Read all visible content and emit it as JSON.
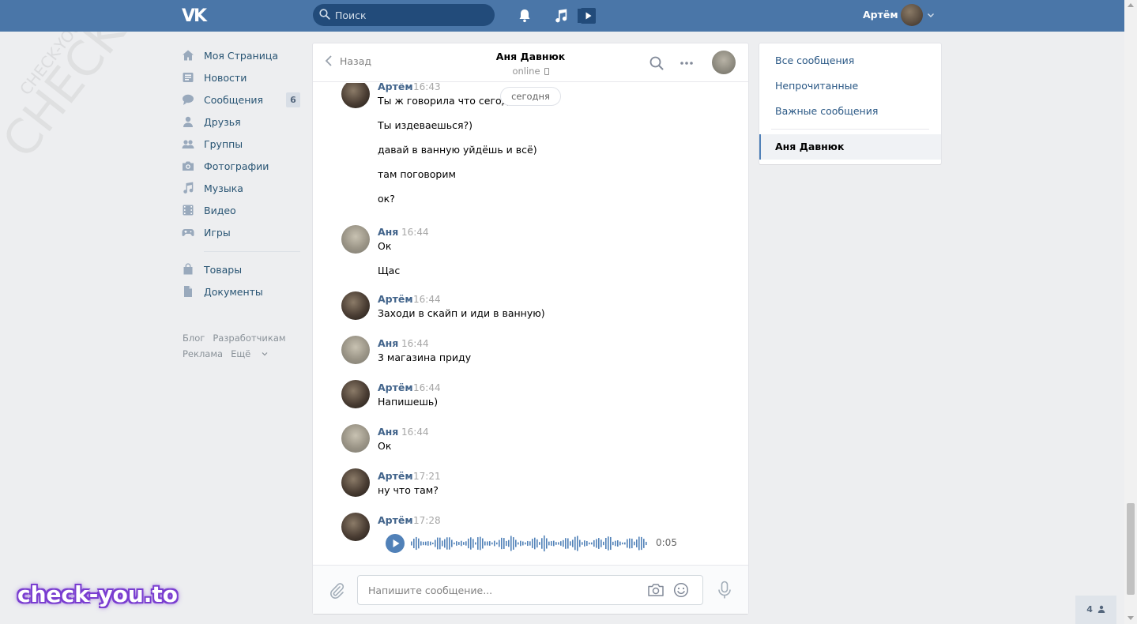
{
  "header": {
    "logo": "VK",
    "search_placeholder": "Поиск",
    "user_name": "Артём"
  },
  "leftnav": {
    "items": [
      {
        "label": "Моя Страница",
        "icon": "home-icon"
      },
      {
        "label": "Новости",
        "icon": "news-icon"
      },
      {
        "label": "Сообщения",
        "icon": "messages-icon",
        "badge": "6"
      },
      {
        "label": "Друзья",
        "icon": "friends-icon"
      },
      {
        "label": "Группы",
        "icon": "groups-icon"
      },
      {
        "label": "Фотографии",
        "icon": "camera-icon"
      },
      {
        "label": "Музыка",
        "icon": "music-icon"
      },
      {
        "label": "Видео",
        "icon": "video-icon"
      },
      {
        "label": "Игры",
        "icon": "games-icon"
      },
      {
        "label": "Товары",
        "icon": "bag-icon"
      },
      {
        "label": "Документы",
        "icon": "document-icon"
      }
    ],
    "footer": [
      "Блог",
      "Разработчикам",
      "Реклама",
      "Ещё"
    ]
  },
  "chat": {
    "back_label": "Назад",
    "peer_name": "Аня Давнюк",
    "peer_status": "online",
    "date_divider": "сегодня",
    "messages": [
      {
        "author": "Артём",
        "time": "16:43",
        "lines": [
          "Ты ж говорила что сегодн",
          "Ты издеваешься?)",
          "давай в ванную уйдёшь и всё)",
          "там поговорим",
          "ок?"
        ]
      },
      {
        "author": "Аня",
        "time": "16:44",
        "lines": [
          "Ок",
          "Щас"
        ]
      },
      {
        "author": "Артём",
        "time": "16:44",
        "lines": [
          "Заходи в скайп и иди в ванную)"
        ]
      },
      {
        "author": "Аня",
        "time": "16:44",
        "lines": [
          "3 магазина приду"
        ]
      },
      {
        "author": "Артём",
        "time": "16:44",
        "lines": [
          "Напишешь)"
        ]
      },
      {
        "author": "Аня",
        "time": "16:44",
        "lines": [
          "Ок"
        ]
      },
      {
        "author": "Артём",
        "time": "17:21",
        "lines": [
          "ну что там?"
        ]
      },
      {
        "author": "Артём",
        "time": "17:28",
        "voice_duration": "0:05"
      }
    ],
    "composer_placeholder": "Напишите сообщение..."
  },
  "rightpanel": {
    "items": [
      "Все сообщения",
      "Непрочитанные",
      "Важные сообщения"
    ],
    "active_dialog": "Аня Давнюк"
  },
  "online_counter": "4",
  "watermarks": {
    "big": "CHECK-YOU.ME",
    "small": "CHECK-YOU.ME",
    "brand": "check-you.to"
  },
  "colors": {
    "header": "#4a76a8",
    "link": "#2a5885",
    "author": "#42648b",
    "accent": "#5181b8"
  }
}
